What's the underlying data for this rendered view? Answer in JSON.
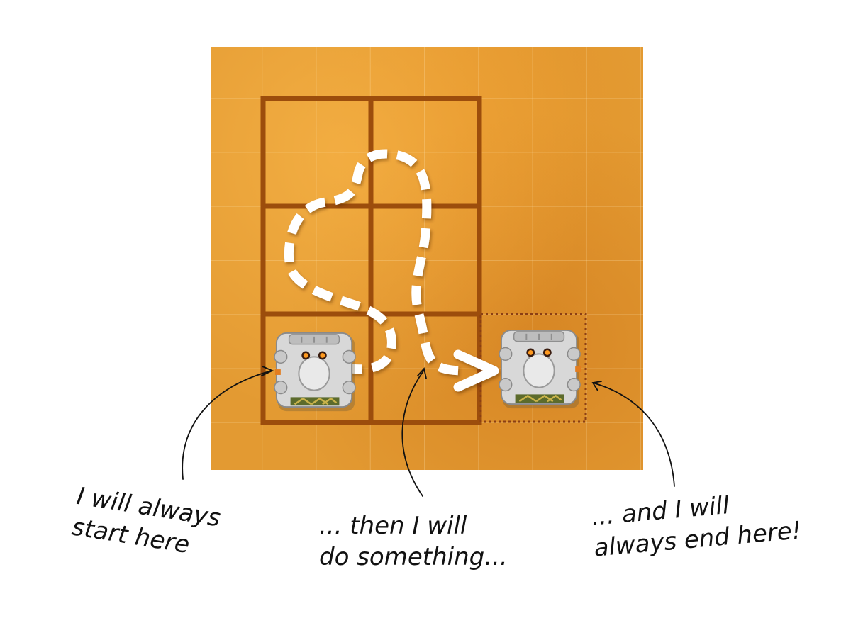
{
  "level": {
    "grid_columns": 2,
    "grid_rows": 3,
    "start_cell": {
      "column": 1,
      "row": 3
    },
    "end_cell": {
      "column": 3,
      "row": 3
    }
  },
  "robots": [
    {
      "role": "start",
      "icon": "robot-icon",
      "facing": "left"
    },
    {
      "role": "end",
      "icon": "robot-icon",
      "facing": "right"
    }
  ],
  "path": {
    "icon": "dashed-path-arrow-icon",
    "color": "#ffffff"
  },
  "captions": {
    "start": [
      "I will always",
      "start here"
    ],
    "middle": [
      "... then I will",
      "do something..."
    ],
    "end": [
      "... and I will",
      "always end here!"
    ]
  },
  "colors": {
    "board": "#e39a32",
    "grid_lines": "#9c4d0c",
    "end_marker": "#8b3f14",
    "path": "#ffffff",
    "text": "#111111"
  }
}
